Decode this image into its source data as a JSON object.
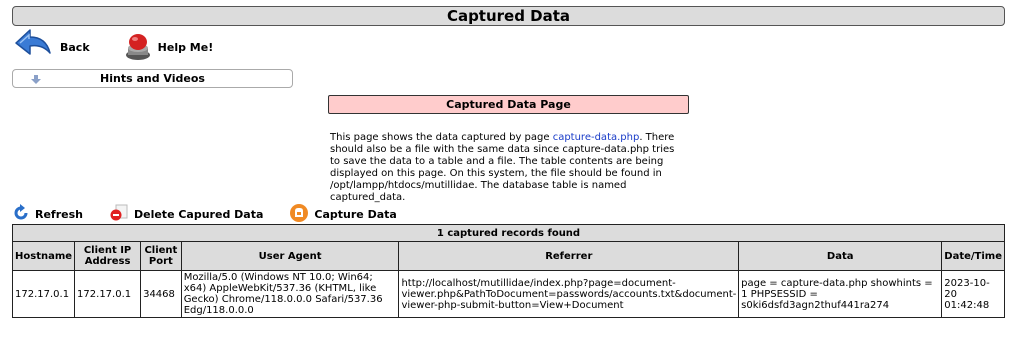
{
  "page": {
    "title": "Captured Data"
  },
  "nav": {
    "back_label": "Back",
    "help_label": "Help Me!"
  },
  "hints": {
    "label": "Hints and Videos"
  },
  "section": {
    "header": "Captured Data Page",
    "desc_before": "This page shows the data captured by page ",
    "desc_link": "capture-data.php",
    "desc_after": ". There should also be a file with the same data since capture-data.php tries to save the data to a table and a file. The table contents are being displayed on this page. On this system, the file should be found in /opt/lampp/htdocs/mutillidae. The database table is named captured_data."
  },
  "actions": {
    "refresh_label": "Refresh",
    "delete_label": "Delete Capured Data",
    "capture_label": "Capture Data"
  },
  "table": {
    "count_label": "1 captured records found",
    "headers": [
      "Hostname",
      "Client IP Address",
      "Client Port",
      "User Agent",
      "Referrer",
      "Data",
      "Date/Time"
    ],
    "rows": [
      {
        "hostname": "172.17.0.1",
        "client_ip": "172.17.0.1",
        "client_port": "34468",
        "user_agent": "Mozilla/5.0 (Windows NT 10.0; Win64; x64) AppleWebKit/537.36 (KHTML, like Gecko) Chrome/118.0.0.0 Safari/537.36 Edg/118.0.0.0",
        "referrer": "http://localhost/mutillidae/index.php?page=document-viewer.php&PathToDocument=passwords/accounts.txt&document-viewer-php-submit-button=View+Document",
        "data": "page = capture-data.php showhints = 1 PHPSESSID = s0ki6dsfd3agn2thuf441ra274",
        "datetime": "2023-10-20 01:42:48"
      }
    ]
  },
  "colors": {
    "title_bg": "#dcdcdc",
    "section_header_bg": "#ffcccc",
    "link": "#1a3cc8"
  },
  "icons": {
    "back": "back-arrow-icon",
    "help": "help-button-icon",
    "hints": "down-arrow-icon",
    "refresh": "refresh-icon",
    "delete": "delete-icon",
    "capture": "capture-icon"
  }
}
